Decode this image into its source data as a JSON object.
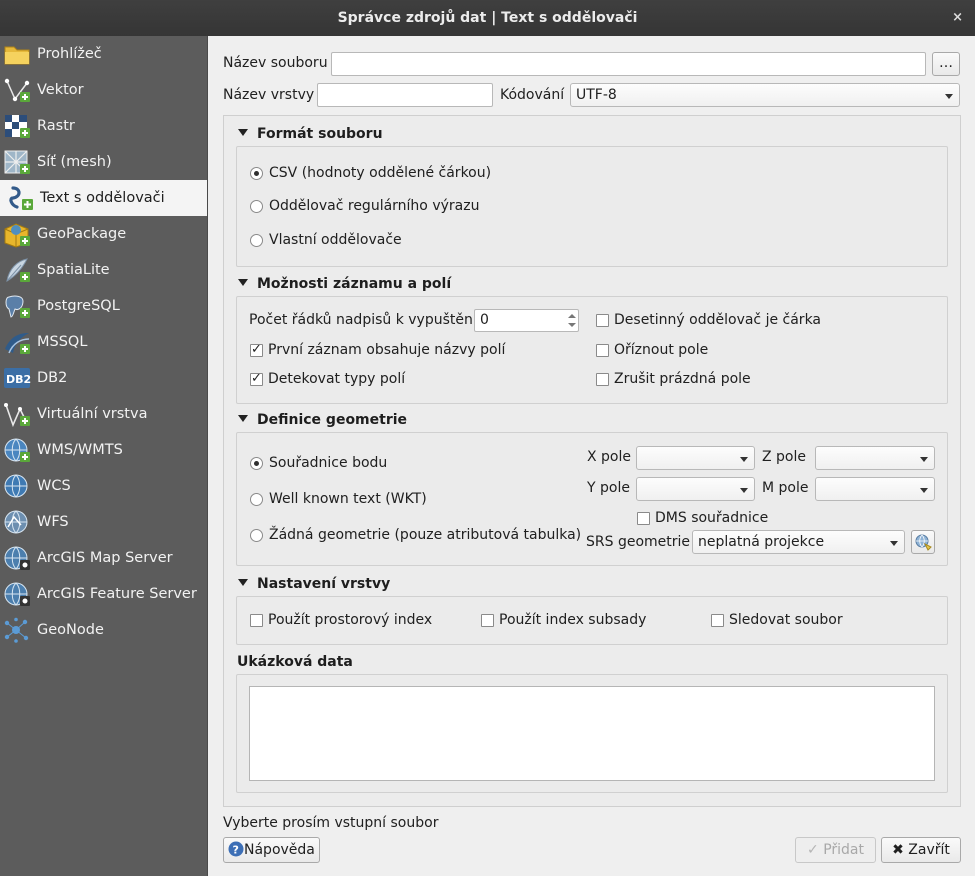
{
  "window": {
    "title": "Správce zdrojů dat | Text s oddělovači",
    "close_glyph": "×"
  },
  "sidebar": {
    "items": [
      {
        "label": "Prohlížeč",
        "icon": "folder-icon"
      },
      {
        "label": "Vektor",
        "icon": "vector-layer-icon"
      },
      {
        "label": "Rastr",
        "icon": "raster-layer-icon"
      },
      {
        "label": "Síť (mesh)",
        "icon": "mesh-layer-icon"
      },
      {
        "label": "Text s oddělovači",
        "icon": "delimited-text-icon"
      },
      {
        "label": "GeoPackage",
        "icon": "geopackage-icon"
      },
      {
        "label": "SpatiaLite",
        "icon": "spatialite-icon"
      },
      {
        "label": "PostgreSQL",
        "icon": "postgresql-icon"
      },
      {
        "label": "MSSQL",
        "icon": "mssql-icon"
      },
      {
        "label": "DB2",
        "icon": "db2-icon"
      },
      {
        "label": "Virtuální vrstva",
        "icon": "virtual-layer-icon"
      },
      {
        "label": "WMS/WMTS",
        "icon": "wms-icon"
      },
      {
        "label": "WCS",
        "icon": "wcs-icon"
      },
      {
        "label": "WFS",
        "icon": "wfs-icon"
      },
      {
        "label": "ArcGIS Map Server",
        "icon": "arcgis-map-server-icon"
      },
      {
        "label": "ArcGIS Feature Server",
        "icon": "arcgis-feature-server-icon"
      },
      {
        "label": "GeoNode",
        "icon": "geonode-icon"
      }
    ],
    "active_index": 4
  },
  "file": {
    "filename_label": "Název souboru",
    "filename_value": "",
    "browse_label": "…",
    "layername_label": "Název vrstvy",
    "layername_value": "",
    "encoding_label": "Kódování",
    "encoding_value": "UTF-8"
  },
  "format": {
    "title": "Formát souboru",
    "options": [
      {
        "label": "CSV (hodnoty oddělené čárkou)",
        "selected": true
      },
      {
        "label": "Oddělovač regulárního výrazu",
        "selected": false
      },
      {
        "label": "Vlastní oddělovače",
        "selected": false
      }
    ]
  },
  "records": {
    "title": "Možnosti záznamu a polí",
    "skip_lines_label": "Počet řádků nadpisů k vypuštění",
    "skip_lines_value": "0",
    "first_record_names": {
      "label": "První záznam obsahuje názvy polí",
      "checked": true
    },
    "detect_types": {
      "label": "Detekovat typy polí",
      "checked": true
    },
    "decimal_comma": {
      "label": "Desetinný oddělovač je čárka",
      "checked": false
    },
    "trim_fields": {
      "label": "Oříznout pole",
      "checked": false
    },
    "discard_empty": {
      "label": "Zrušit prázdná pole",
      "checked": false
    }
  },
  "geometry": {
    "title": "Definice geometrie",
    "options": [
      {
        "label": "Souřadnice bodu",
        "selected": true
      },
      {
        "label": "Well known text (WKT)",
        "selected": false
      },
      {
        "label": "Žádná geometrie (pouze atributová tabulka)",
        "selected": false
      }
    ],
    "x_label": "X pole",
    "x_value": "",
    "y_label": "Y pole",
    "y_value": "",
    "z_label": "Z pole",
    "z_value": "",
    "m_label": "M pole",
    "m_value": "",
    "dms": {
      "label": "DMS souřadnice",
      "checked": false
    },
    "srs_label": "SRS geometrie",
    "srs_value": "neplatná projekce"
  },
  "layer_settings": {
    "title": "Nastavení vrstvy",
    "spatial_index": {
      "label": "Použít prostorový index",
      "checked": false
    },
    "subset_index": {
      "label": "Použít index subsady",
      "checked": false
    },
    "watch_file": {
      "label": "Sledovat soubor",
      "checked": false
    }
  },
  "sample": {
    "title": "Ukázková data"
  },
  "status": {
    "text": "Vyberte prosím vstupní soubor"
  },
  "buttons": {
    "help": "Nápověda",
    "add": "Přidat",
    "close": "Zavřít"
  },
  "colors": {
    "titlebar": "#383838",
    "sidebar": "#5c5c5c",
    "sidebar_active": "#f4f4f4",
    "dialog_bg": "#efefef"
  }
}
